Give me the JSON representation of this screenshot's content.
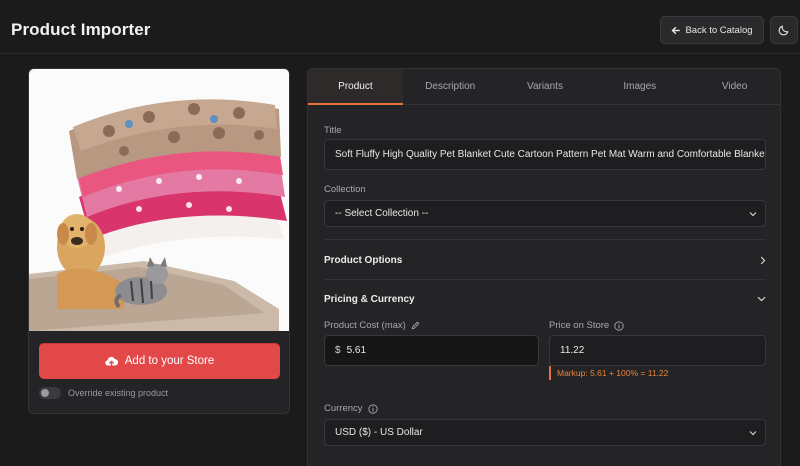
{
  "header": {
    "title": "Product Importer",
    "back_label": "Back to Catalog"
  },
  "product": {
    "add_button_label": "Add to your Store",
    "override_label": "Override existing product",
    "override_enabled": false
  },
  "tabs": [
    {
      "label": "Product",
      "active": true
    },
    {
      "label": "Description",
      "active": false
    },
    {
      "label": "Variants",
      "active": false
    },
    {
      "label": "Images",
      "active": false
    },
    {
      "label": "Video",
      "active": false
    }
  ],
  "form": {
    "title_label": "Title",
    "title_value": "Soft Fluffy High Quality Pet Blanket Cute Cartoon Pattern Pet Mat Warm and Comfortable Blanket",
    "collection_label": "Collection",
    "collection_value": "-- Select Collection --",
    "product_options_label": "Product Options",
    "pricing_label": "Pricing & Currency",
    "cost_label": "Product Cost (max)",
    "cost_prefix": "$",
    "cost_value": "5.61",
    "price_label": "Price on Store",
    "price_value": "11.22",
    "markup_text": "Markup: 5.61 + 100% = 11.22",
    "currency_label": "Currency",
    "currency_value": "USD ($) - US Dollar"
  },
  "colors": {
    "accent": "#e8723e",
    "add_button": "#e24848",
    "background": "#1b1b1c"
  },
  "icons": [
    "arrow-left-icon",
    "moon-icon",
    "cloud-upload-icon",
    "pencil-icon",
    "info-icon",
    "chevron-right-icon",
    "chevron-down-icon"
  ]
}
